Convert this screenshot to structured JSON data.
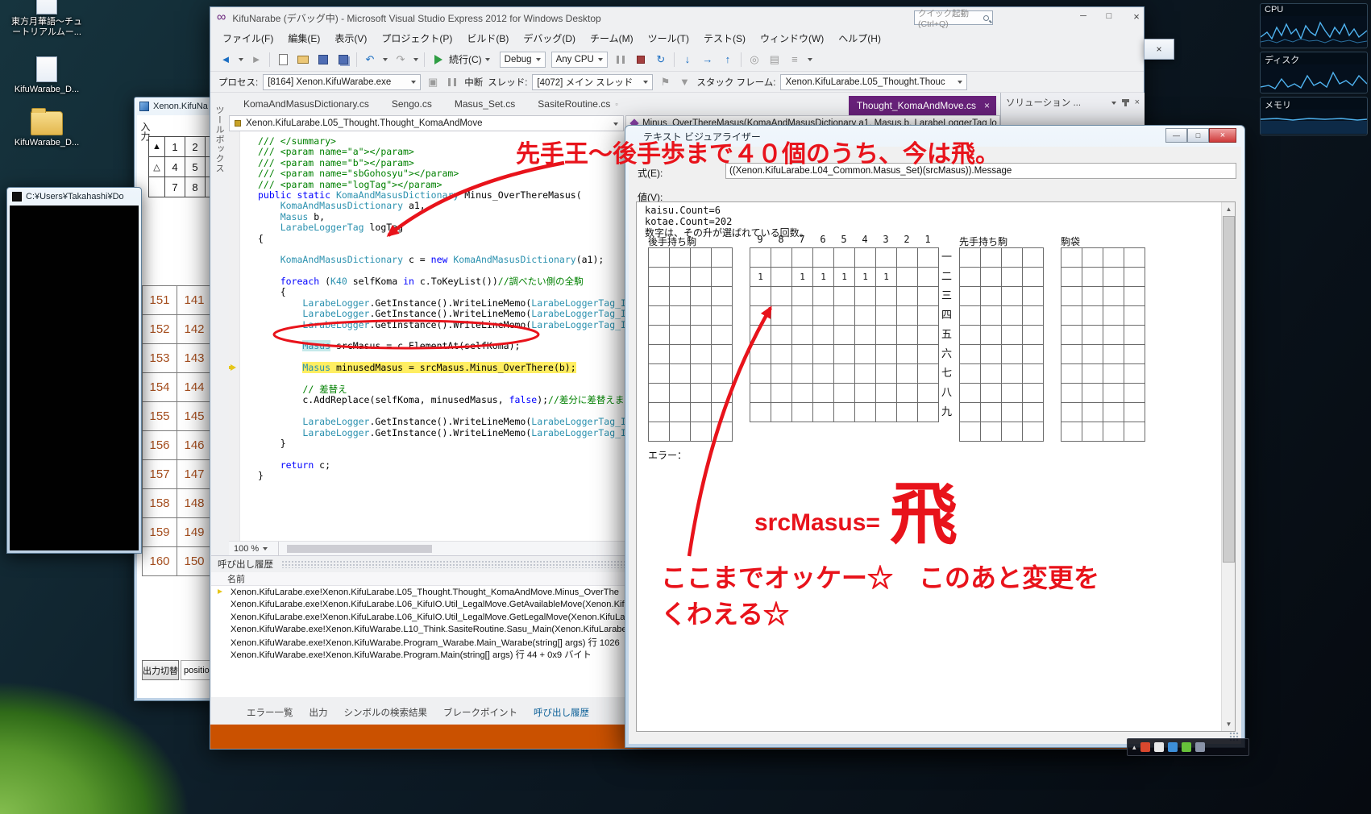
{
  "desktop": {
    "icons": [
      {
        "label": "東方月華語〜チュ\nートリアルムー...",
        "type": "doc"
      },
      {
        "label": "KifuWarabe_D...",
        "type": "doc"
      },
      {
        "label": "KifuWarabe_D...",
        "type": "folder"
      }
    ]
  },
  "gadgets": {
    "cpu": "CPU",
    "disk": "ディスク",
    "memory": "メモリ"
  },
  "console": {
    "title": "C:¥Users¥Takahashi¥Do"
  },
  "grid_window": {
    "title": "Xenon.KifuNa",
    "input_label": "入力",
    "mini_grid_rows": [
      [
        "▲",
        "1",
        "2"
      ],
      [
        "△",
        "4",
        "5"
      ],
      [
        "",
        "7",
        "8"
      ]
    ],
    "table_rows": [
      [
        "151",
        "141"
      ],
      [
        "152",
        "142"
      ],
      [
        "153",
        "143"
      ],
      [
        "154",
        "144"
      ],
      [
        "155",
        "145"
      ],
      [
        "156",
        "146"
      ],
      [
        "157",
        "147"
      ],
      [
        "158",
        "148"
      ],
      [
        "159",
        "149"
      ],
      [
        "160",
        "150"
      ]
    ],
    "output_toggle": "出力切替",
    "position_label": "positio"
  },
  "vs": {
    "title": "KifuNarabe (デバッグ中) - Microsoft Visual Studio Express 2012 for Windows Desktop",
    "quick_launch": "クイック起動 (Ctrl+Q)",
    "menus": [
      "ファイル(F)",
      "編集(E)",
      "表示(V)",
      "プロジェクト(P)",
      "ビルド(B)",
      "デバッグ(D)",
      "チーム(M)",
      "ツール(T)",
      "テスト(S)",
      "ウィンドウ(W)",
      "ヘルプ(H)"
    ],
    "toolbar": {
      "continue_label": "続行(C)",
      "config": "Debug",
      "platform": "Any CPU"
    },
    "process_bar": {
      "process_label": "プロセス:",
      "process_value": "[8164] Xenon.KifuWarabe.exe",
      "break_label": "中断",
      "thread_label": "スレッド:",
      "thread_value": "[4072] メイン スレッド",
      "frame_label": "スタック フレーム:",
      "frame_value": "Xenon.KifuLarabe.L05_Thought.Thouc"
    },
    "tabs": [
      "KomaAndMasusDictionary.cs",
      "Sengo.cs",
      "Masus_Set.cs",
      "SasiteRoutine.cs"
    ],
    "active_tab": "Thought_KomaAndMove.cs",
    "solution_pane_title": "ソリューション ...",
    "side_tab": "ツールボックス",
    "breadcrumb_type": "Xenon.KifuLarabe.L05_Thought.Thought_KomaAndMove",
    "breadcrumb_member": "Minus_OverThereMasus(KomaAndMasusDictionary a1, Masus b, LarabeLoggerTag lo",
    "zoom": "100 %",
    "code_lines": [
      {
        "s": [
          [
            "c",
            "/// </summary>"
          ]
        ]
      },
      {
        "s": [
          [
            "c",
            "/// <param name=\"a\"></param>"
          ]
        ]
      },
      {
        "s": [
          [
            "c",
            "/// <param name=\"b\"></param>"
          ]
        ]
      },
      {
        "s": [
          [
            "c",
            "/// <param name=\"sbGohosyu\"></param>"
          ]
        ]
      },
      {
        "s": [
          [
            "c",
            "/// <param name=\"logTag\"></param>"
          ]
        ]
      },
      {
        "s": [
          [
            "k",
            "public"
          ],
          [
            "p",
            " "
          ],
          [
            "k",
            "static"
          ],
          [
            "p",
            " "
          ],
          [
            "t",
            "KomaAndMasusDictionary"
          ],
          [
            "p",
            " Minus_OverThereMasus("
          ]
        ]
      },
      {
        "s": [
          [
            "p",
            "    "
          ],
          [
            "t",
            "KomaAndMasusDictionary"
          ],
          [
            "p",
            " a1,"
          ]
        ]
      },
      {
        "s": [
          [
            "p",
            "    "
          ],
          [
            "t",
            "Masus"
          ],
          [
            "p",
            " b,"
          ]
        ]
      },
      {
        "s": [
          [
            "p",
            "    "
          ],
          [
            "t",
            "LarabeLoggerTag"
          ],
          [
            "p",
            " logTag"
          ]
        ]
      },
      {
        "s": [
          [
            "p",
            "{"
          ]
        ]
      },
      {
        "s": []
      },
      {
        "s": [
          [
            "p",
            "    "
          ],
          [
            "t",
            "KomaAndMasusDictionary"
          ],
          [
            "p",
            " c = "
          ],
          [
            "k",
            "new"
          ],
          [
            "p",
            " "
          ],
          [
            "t",
            "KomaAndMasusDictionary"
          ],
          [
            "p",
            "(a1);"
          ]
        ]
      },
      {
        "s": []
      },
      {
        "s": [
          [
            "p",
            "    "
          ],
          [
            "k",
            "foreach"
          ],
          [
            "p",
            " ("
          ],
          [
            "t",
            "K40"
          ],
          [
            "p",
            " selfKoma "
          ],
          [
            "k",
            "in"
          ],
          [
            "p",
            " c.ToKeyList())"
          ],
          [
            "c",
            "//調べたい側の全駒"
          ]
        ]
      },
      {
        "s": [
          [
            "p",
            "    {"
          ]
        ]
      },
      {
        "s": [
          [
            "p",
            "        "
          ],
          [
            "t",
            "LarabeLogger"
          ],
          [
            "p",
            ".GetInstance().WriteLineMemo("
          ],
          [
            "t",
            "LarabeLoggerTag_Impl"
          ],
          [
            "p",
            ".B"
          ]
        ]
      },
      {
        "s": [
          [
            "p",
            "        "
          ],
          [
            "t",
            "LarabeLogger"
          ],
          [
            "p",
            ".GetInstance().WriteLineMemo("
          ],
          [
            "t",
            "LarabeLoggerTag_Impl"
          ],
          [
            "p",
            ".B"
          ]
        ]
      },
      {
        "s": [
          [
            "p",
            "        "
          ],
          [
            "t",
            "LarabeLogger"
          ],
          [
            "p",
            ".GetInstance().WriteLineMemo("
          ],
          [
            "t",
            "LarabeLoggerTag_Impl"
          ],
          [
            "p",
            ".B"
          ]
        ]
      },
      {
        "s": []
      },
      {
        "s": [
          [
            "p",
            "        "
          ],
          [
            "m",
            "Masus"
          ],
          [
            "p",
            " srcMasus = c.ElementAt(selfKoma);"
          ]
        ]
      },
      {
        "s": []
      },
      {
        "cur": true,
        "s": [
          [
            "p",
            "        "
          ],
          [
            "t",
            "Masus"
          ],
          [
            "p",
            " minusedMasus = srcMasus.Minus_OverThere(b);"
          ]
        ]
      },
      {
        "s": []
      },
      {
        "s": [
          [
            "p",
            "        "
          ],
          [
            "c",
            "// 差替え"
          ]
        ]
      },
      {
        "s": [
          [
            "p",
            "        c.AddReplace(selfKoma, minusedMasus, "
          ],
          [
            "k",
            "false"
          ],
          [
            "p",
            ");"
          ],
          [
            "c",
            "//差分に差替えます"
          ]
        ]
      },
      {
        "s": []
      },
      {
        "s": [
          [
            "p",
            "        "
          ],
          [
            "t",
            "LarabeLogger"
          ],
          [
            "p",
            ".GetInstance().WriteLineMemo("
          ],
          [
            "t",
            "LarabeLoggerTag_Impl"
          ],
          [
            "p",
            ".B"
          ]
        ]
      },
      {
        "s": [
          [
            "p",
            "        "
          ],
          [
            "t",
            "LarabeLogger"
          ],
          [
            "p",
            ".GetInstance().WriteLineMemo("
          ],
          [
            "t",
            "LarabeLoggerTag_Impl"
          ],
          [
            "p",
            ".B"
          ]
        ]
      },
      {
        "s": [
          [
            "p",
            "    }"
          ]
        ]
      },
      {
        "s": []
      },
      {
        "s": [
          [
            "p",
            "    "
          ],
          [
            "k",
            "return"
          ],
          [
            "p",
            " c;"
          ]
        ]
      },
      {
        "s": [
          [
            "p",
            "}"
          ]
        ]
      }
    ],
    "callstack": {
      "title": "呼び出し履歴",
      "column": "名前",
      "rows": [
        "Xenon.KifuLarabe.exe!Xenon.KifuLarabe.L05_Thought.Thought_KomaAndMove.Minus_OverThe",
        "Xenon.KifuLarabe.exe!Xenon.KifuLarabe.L06_KifuIO.Util_LegalMove.GetAvailableMove(Xenon.Kif",
        "Xenon.KifuLarabe.exe!Xenon.KifuLarabe.L06_KifuIO.Util_LegalMove.GetLegalMove(Xenon.KifuLa",
        "Xenon.KifuWarabe.exe!Xenon.KifuWarabe.L10_Think.SasiteRoutine.Sasu_Main(Xenon.KifuLarabe",
        "Xenon.KifuWarabe.exe!Xenon.KifuWarabe.Program_Warabe.Main_Warabe(string[] args) 行 1026",
        "Xenon.KifuWarabe.exe!Xenon.KifuWarabe.Program.Main(string[] args) 行 44 + 0x9 バイト"
      ]
    },
    "bottom_tabs": [
      "エラー一覧",
      "出力",
      "シンボルの検索結果",
      "ブレークポイント",
      "呼び出し履歴"
    ],
    "active_bottom_index": 4
  },
  "visualizer": {
    "title": "テキスト ビジュアライザー",
    "expression_label": "式(E):",
    "expression": "((Xenon.KifuLarabe.L04_Common.Masus_Set)(srcMasus)).Message",
    "value_label": "値(V):",
    "value_lines": [
      "kaisu.Count=6",
      "kotae.Count=202",
      "数字は、その升が選ばれている回数。"
    ],
    "board": {
      "gote_label": "後手持ち駒",
      "sente_label": "先手持ち駒",
      "bag_label": "駒袋",
      "col_headers": [
        "9",
        "8",
        "7",
        "6",
        "5",
        "4",
        "3",
        "2",
        "1"
      ],
      "row_labels": [
        "一",
        "二",
        "三",
        "四",
        "五",
        "六",
        "七",
        "八",
        "九"
      ],
      "marks": [
        [
          1,
          0
        ],
        [
          1,
          2
        ],
        [
          1,
          3
        ],
        [
          1,
          4
        ],
        [
          1,
          5
        ],
        [
          1,
          6
        ]
      ],
      "mark_value": "1"
    },
    "error_label": "エラー："
  },
  "annotations": {
    "color": "#e8131b",
    "top_text": "先手王〜後手歩まで４０個のうち、今は飛。",
    "src_label": "srcMasus=",
    "piece": "飛",
    "note_line1": "ここまでオッケー☆　このあと変更を",
    "note_line2": "くわえる☆"
  }
}
